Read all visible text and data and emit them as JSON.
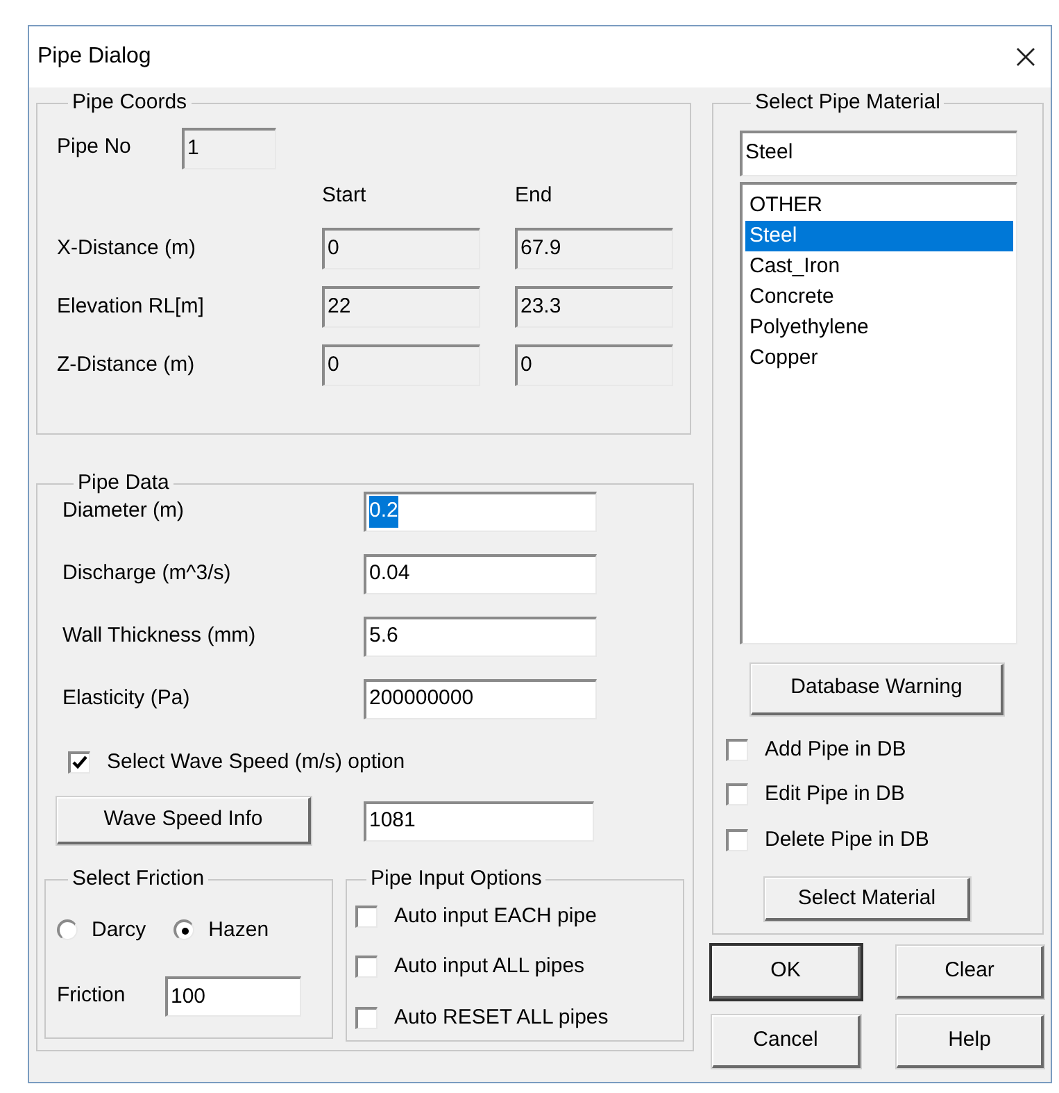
{
  "window": {
    "title": "Pipe Dialog"
  },
  "pipe_coords": {
    "title": "Pipe Coords",
    "pipe_no": {
      "label": "Pipe No",
      "value": "1"
    },
    "columns": [
      "Start",
      "End"
    ],
    "rows": [
      {
        "label": "X-Distance (m)",
        "start": "0",
        "end": "67.9"
      },
      {
        "label": "Elevation RL[m]",
        "start": "22",
        "end": "23.3"
      },
      {
        "label": "Z-Distance (m)",
        "start": "0",
        "end": "0"
      }
    ]
  },
  "pipe_data": {
    "title": "Pipe Data",
    "fields": [
      {
        "label": "Diameter (m)",
        "value": "0.2",
        "highlighted": true
      },
      {
        "label": "Discharge (m^3/s)",
        "value": "0.04",
        "highlighted": false
      },
      {
        "label": "Wall Thickness (mm)",
        "value": "5.6",
        "highlighted": false
      },
      {
        "label": "Elasticity (Pa)",
        "value": "200000000",
        "highlighted": false
      }
    ],
    "wave_speed_option": {
      "label": "Select Wave Speed (m/s) option",
      "checked": true
    },
    "wave_speed_button": "Wave Speed Info",
    "wave_speed_value": "1081",
    "friction": {
      "title": "Select Friction",
      "options": [
        {
          "label": "Darcy",
          "selected": false
        },
        {
          "label": "Hazen",
          "selected": true
        }
      ],
      "label": "Friction",
      "value": "100"
    },
    "input_options": {
      "title": "Pipe Input Options",
      "options": [
        {
          "label": "Auto input EACH pipe",
          "checked": false
        },
        {
          "label": "Auto input ALL pipes",
          "checked": false
        },
        {
          "label": "Auto RESET ALL pipes",
          "checked": false
        }
      ]
    }
  },
  "material": {
    "title": "Select Pipe Material",
    "value": "Steel",
    "items": [
      {
        "label": "OTHER",
        "selected": false
      },
      {
        "label": "Steel",
        "selected": true
      },
      {
        "label": "Cast_Iron",
        "selected": false
      },
      {
        "label": "Concrete",
        "selected": false
      },
      {
        "label": "Polyethylene",
        "selected": false
      },
      {
        "label": "Copper",
        "selected": false
      }
    ],
    "warning_button": "Database Warning",
    "options": [
      {
        "label": "Add Pipe in DB",
        "checked": false
      },
      {
        "label": "Edit Pipe in DB",
        "checked": false
      },
      {
        "label": "Delete Pipe in DB",
        "checked": false
      }
    ],
    "select_button": "Select Material"
  },
  "buttons": [
    {
      "label": "OK",
      "default": true
    },
    {
      "label": "Clear",
      "default": false
    },
    {
      "label": "Cancel",
      "default": false
    },
    {
      "label": "Help",
      "default": false
    }
  ]
}
